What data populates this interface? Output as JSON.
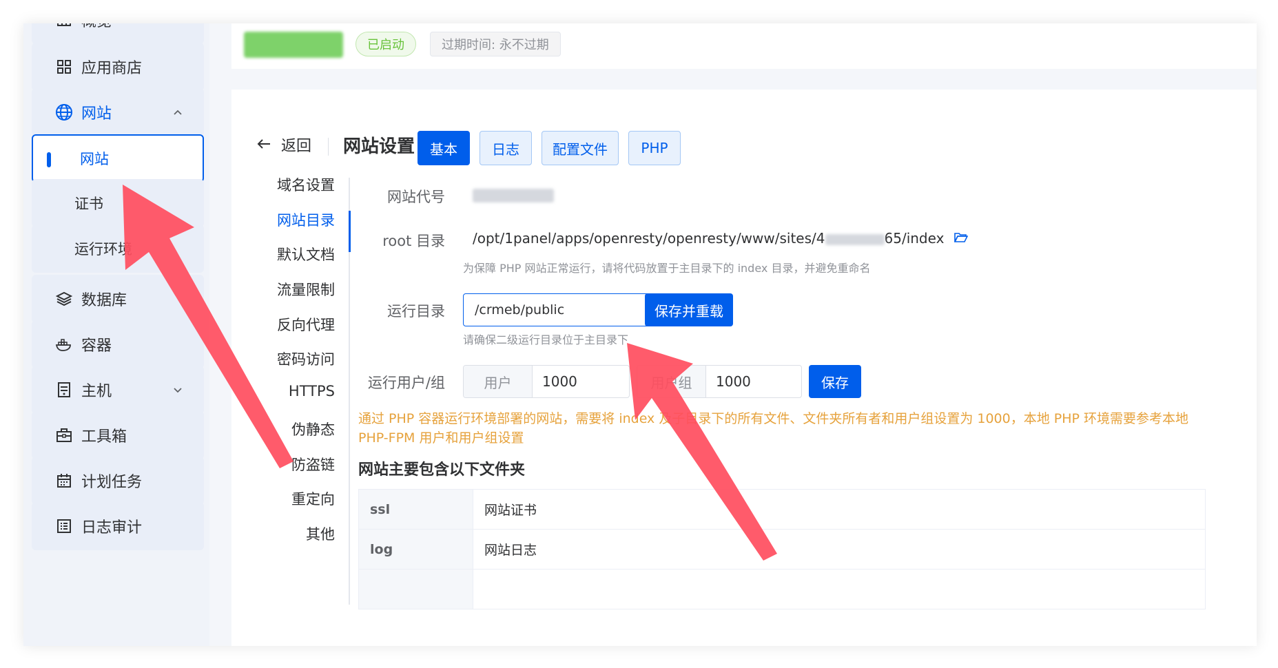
{
  "sidebar": {
    "overview_label": "概览",
    "app_store_label": "应用商店",
    "website_group_label": "网站",
    "website_sub_label": "网站",
    "cert_label": "证书",
    "runtime_label": "运行环境",
    "database_label": "数据库",
    "container_label": "容器",
    "host_label": "主机",
    "toolbox_label": "工具箱",
    "cron_label": "计划任务",
    "log_audit_label": "日志审计"
  },
  "topbar": {
    "status_tag": "已启动",
    "expire_tag": "过期时间: 永不过期"
  },
  "header": {
    "back_label": "返回",
    "title": "网站设置",
    "tabs": [
      {
        "label": "基本",
        "active": true
      },
      {
        "label": "日志",
        "active": false
      },
      {
        "label": "配置文件",
        "active": false
      },
      {
        "label": "PHP",
        "active": false
      }
    ]
  },
  "side_nav": {
    "items": [
      "域名设置",
      "网站目录",
      "默认文档",
      "流量限制",
      "反向代理",
      "密码访问",
      "HTTPS",
      "伪静态",
      "防盗链",
      "重定向",
      "其他"
    ],
    "active_index": 1
  },
  "form": {
    "site_code_label": "网站代号",
    "root_label": "root 目录",
    "root_prefix": "/opt/1panel/apps/openresty/openresty/www/sites/4",
    "root_suffix": "65/index",
    "root_hint": "为保障 PHP 网站正常运行，请将代码放置于主目录下的 index 目录，并避免重命名",
    "run_dir_label": "运行目录",
    "run_dir_value": "/crmeb/public",
    "save_reload_label": "保存并重载",
    "run_dir_hint": "请确保二级运行目录位于主目录下",
    "run_user_label": "运行用户/组",
    "user_prefix": "用户",
    "user_value": "1000",
    "group_prefix": "用户组",
    "group_value": "1000",
    "save_label": "保存",
    "warning": "通过 PHP 容器运行环境部署的网站，需要将 index 及子目录下的所有文件、文件夹所有者和用户组设置为 1000，本地 PHP 环境需要参考本地 PHP-FPM 用户和用户组设置"
  },
  "folders": {
    "title": "网站主要包含以下文件夹",
    "rows": [
      {
        "name": "ssl",
        "desc": "网站证书"
      },
      {
        "name": "log",
        "desc": "网站日志"
      }
    ]
  },
  "colors": {
    "primary": "#005eeb",
    "success": "#67c23a",
    "warning": "#e6a23c",
    "annotation_arrow": "#ff4d5e"
  }
}
